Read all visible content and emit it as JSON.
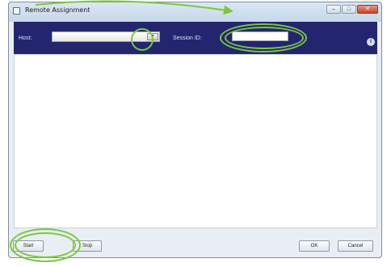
{
  "window": {
    "title": "Remote Assignment",
    "min_glyph": "–",
    "max_glyph": "□",
    "close_glyph": "✕"
  },
  "toolbar": {
    "host_label": "Host:",
    "dropdown_glyph": "▾",
    "session_label": "Session ID:",
    "session_value": "",
    "info_glyph": "i"
  },
  "buttons": {
    "start": "Start",
    "stop": "Stop",
    "ok": "OK",
    "cancel": "Cancel"
  },
  "colors": {
    "toolbar_bg": "#23266e",
    "annotation": "#7cc83b"
  }
}
